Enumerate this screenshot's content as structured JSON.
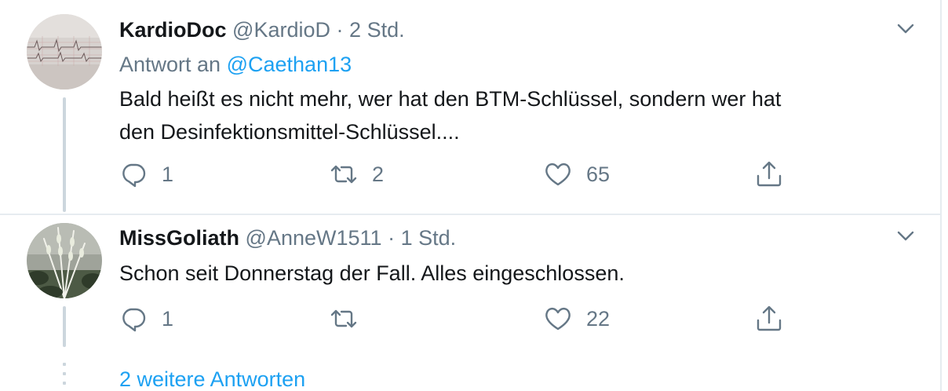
{
  "tweets": [
    {
      "name": "KardioDoc",
      "handle": "@KardioD",
      "separator": "·",
      "time": "2 Std.",
      "reply_label": "Antwort an",
      "reply_mention": "@Caethan13",
      "text_line1": "Bald heißt es nicht mehr, wer hat den BTM-Schlüssel, sondern wer hat",
      "text_line2": "den Desinfektionsmittel-Schlüssel....",
      "reply_count": "1",
      "retweet_count": "2",
      "like_count": "65"
    },
    {
      "name": "MissGoliath",
      "handle": "@AnneW1511",
      "separator": "·",
      "time": "1 Std.",
      "text_line1": "Schon seit Donnerstag der Fall. Alles eingeschlossen.",
      "reply_count": "1",
      "retweet_count": "",
      "like_count": "22"
    }
  ],
  "more_replies": "2 weitere Antworten",
  "icons": {
    "reply": "reply-icon",
    "retweet": "retweet-icon",
    "like": "heart-icon",
    "share": "share-icon",
    "menu": "chevron-down-icon"
  },
  "colors": {
    "text": "#14171a",
    "secondary": "#657786",
    "accent": "#1da1f2",
    "border": "#e6ecf0",
    "thread": "#ccd6dd"
  }
}
